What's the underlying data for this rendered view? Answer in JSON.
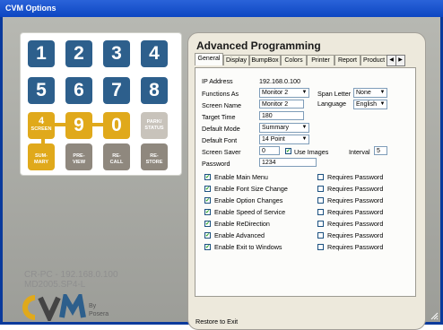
{
  "window": {
    "title": "CVM Options"
  },
  "keypad": {
    "num_keys": [
      "1",
      "2",
      "3",
      "4",
      "5",
      "6",
      "7",
      "8"
    ],
    "key_4": "4",
    "key_4_sub": "SCREEN",
    "key_9": "9",
    "key_0": "0",
    "key_park_line1": "PARK/",
    "key_park_line2": "STATUS",
    "key_summary_line1": "SUM-",
    "key_summary_line2": "MARY",
    "key_preview_line1": "PRE-",
    "key_preview_line2": "VIEW",
    "key_recall_line1": "RE-",
    "key_recall_line2": "CALL",
    "key_restore_line1": "RE-",
    "key_restore_line2": "STORE"
  },
  "branding": {
    "line1": "CR-PC - 192.168.0.100",
    "line2": "MD2005.SP4-L",
    "logo_text": "CVM",
    "by": "By",
    "company": "Posera"
  },
  "panel": {
    "title": "Advanced Programming",
    "tabs": [
      "General",
      "Display",
      "BumpBox",
      "Colors",
      "Printer",
      "Report",
      "Product"
    ],
    "active_tab": "General",
    "ip_label": "IP Address",
    "ip_value": "192.168.0.100",
    "functions_as_label": "Functions As",
    "functions_as_value": "Monitor 2",
    "span_letter_label": "Span Letter",
    "span_letter_value": "None",
    "screen_name_label": "Screen Name",
    "screen_name_value": "Monitor 2",
    "language_label": "Language",
    "language_value": "English",
    "target_time_label": "Target Time",
    "target_time_value": "180",
    "default_mode_label": "Default Mode",
    "default_mode_value": "Summary",
    "default_font_label": "Default Font",
    "default_font_value": "14 Point",
    "screen_saver_label": "Screen Saver",
    "screen_saver_value": "0",
    "use_images_label": "Use Images",
    "interval_label": "Interval",
    "interval_value": "5",
    "password_label": "Password",
    "password_value": "1234",
    "options": [
      {
        "label": "Enable Main Menu",
        "req": "Requires Password"
      },
      {
        "label": "Enable Font Size Change",
        "req": "Requires Password"
      },
      {
        "label": "Enable Option Changes",
        "req": "Requires Password"
      },
      {
        "label": "Enable Speed of Service",
        "req": "Requires Password"
      },
      {
        "label": "Enable ReDirection",
        "req": "Requires Password"
      },
      {
        "label": "Enable Advanced",
        "req": "Requires Password"
      },
      {
        "label": "Enable Exit to Windows",
        "req": "Requires Password"
      }
    ],
    "footer": "Restore to Exit"
  },
  "colors": {
    "title_bar": "#0d46c2",
    "blue_key": "#2d5f8c",
    "gold_key": "#e0a91b",
    "grey_key": "#8f887e"
  }
}
